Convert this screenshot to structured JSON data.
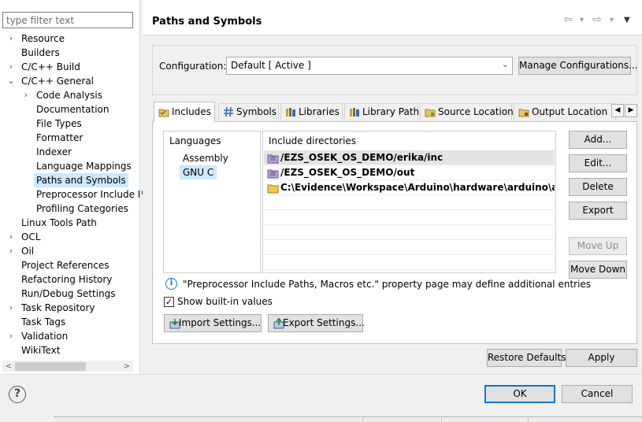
{
  "filter": {
    "placeholder": "type filter text"
  },
  "tree": [
    {
      "label": "Resource",
      "twisty": "›"
    },
    {
      "label": "Builders",
      "twisty": ""
    },
    {
      "label": "C/C++ Build",
      "twisty": "›"
    },
    {
      "label": "C/C++ General",
      "twisty": "⌄"
    },
    {
      "label": "Code Analysis",
      "twisty": "›"
    },
    {
      "label": "Documentation",
      "twisty": ""
    },
    {
      "label": "File Types",
      "twisty": ""
    },
    {
      "label": "Formatter",
      "twisty": ""
    },
    {
      "label": "Indexer",
      "twisty": ""
    },
    {
      "label": "Language Mappings",
      "twisty": ""
    },
    {
      "label": "Paths and Symbols",
      "twisty": ""
    },
    {
      "label": "Preprocessor Include Pa",
      "twisty": ""
    },
    {
      "label": "Profiling Categories",
      "twisty": ""
    },
    {
      "label": "Linux Tools Path",
      "twisty": ""
    },
    {
      "label": "OCL",
      "twisty": "›"
    },
    {
      "label": "Oil",
      "twisty": "›"
    },
    {
      "label": "Project References",
      "twisty": ""
    },
    {
      "label": "Refactoring History",
      "twisty": ""
    },
    {
      "label": "Run/Debug Settings",
      "twisty": ""
    },
    {
      "label": "Task Repository",
      "twisty": "›"
    },
    {
      "label": "Task Tags",
      "twisty": ""
    },
    {
      "label": "Validation",
      "twisty": "›"
    },
    {
      "label": "WikiText",
      "twisty": ""
    }
  ],
  "page": {
    "title": "Paths and Symbols"
  },
  "nav": {
    "back": "⇦",
    "forward": "⇨",
    "dropdown": "▾",
    "menu": "▼"
  },
  "configuration": {
    "label": "Configuration:",
    "value": "Default  [ Active ]",
    "manage_button": "Manage Configurations..."
  },
  "tabs": [
    {
      "label": "Includes",
      "icon": "folder-includes-icon",
      "active": true
    },
    {
      "label": "Symbols",
      "icon": "hash-icon",
      "active": false
    },
    {
      "label": "Libraries",
      "icon": "libraries-icon",
      "active": false
    },
    {
      "label": "Library Paths",
      "icon": "library-paths-icon",
      "active": false
    },
    {
      "label": "Source Location",
      "icon": "source-folder-icon",
      "active": false
    },
    {
      "label": "Output Location",
      "icon": "output-folder-icon",
      "active": false
    }
  ],
  "languages": {
    "header": "Languages",
    "items": [
      {
        "label": "Assembly",
        "selected": false
      },
      {
        "label": "GNU C",
        "selected": true
      }
    ]
  },
  "includes": {
    "header": "Include directories",
    "items": [
      {
        "path": "/EZS_OSEK_OS_DEMO/erika/inc",
        "icon": "workspace-folder-icon",
        "selected": true
      },
      {
        "path": "/EZS_OSEK_OS_DEMO/out",
        "icon": "workspace-folder-icon",
        "selected": false
      },
      {
        "path": "C:\\Evidence\\Workspace\\Arduino\\hardware\\arduino\\avr\\cor...",
        "icon": "filesystem-folder-icon",
        "selected": false
      }
    ]
  },
  "side_buttons": {
    "add": "Add...",
    "edit": "Edit...",
    "delete": "Delete",
    "export": "Export",
    "move_up": "Move Up",
    "move_down": "Move Down"
  },
  "note": "\"Preprocessor Include Paths, Macros etc.\" property page may define additional entries",
  "show_builtin": {
    "label": "Show built-in values",
    "checked": true
  },
  "import_button": "Import Settings...",
  "export_button": "Export Settings...",
  "restore_defaults": "Restore Defaults",
  "apply": "Apply",
  "ok": "OK",
  "cancel": "Cancel"
}
